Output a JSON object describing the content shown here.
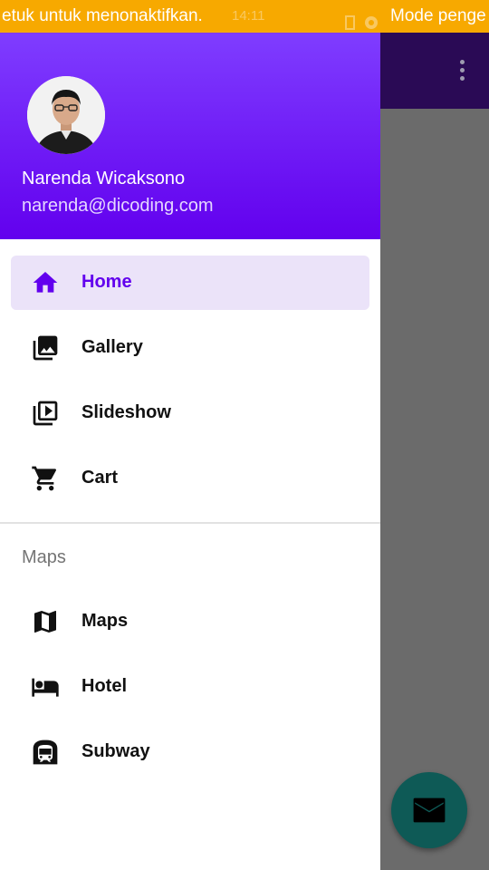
{
  "status_bar": {
    "left_text": "etuk untuk menonaktifkan.",
    "time": "14:11",
    "right_text": "Mode penge",
    "background": "#f7a900"
  },
  "drawer": {
    "header": {
      "name": "Narenda Wicaksono",
      "email": "narenda@dicoding.com",
      "gradient": [
        "#7f3dff",
        "#6200ee"
      ]
    },
    "items": [
      {
        "label": "Home",
        "icon": "home-icon",
        "active": true
      },
      {
        "label": "Gallery",
        "icon": "gallery-icon",
        "active": false
      },
      {
        "label": "Slideshow",
        "icon": "slideshow-icon",
        "active": false
      },
      {
        "label": "Cart",
        "icon": "cart-icon",
        "active": false
      }
    ],
    "section": {
      "title": "Maps",
      "items": [
        {
          "label": "Maps",
          "icon": "map-icon"
        },
        {
          "label": "Hotel",
          "icon": "hotel-icon"
        },
        {
          "label": "Subway",
          "icon": "subway-icon"
        }
      ]
    }
  },
  "fab": {
    "icon": "mail-icon",
    "color": "#0e5a56"
  },
  "colors": {
    "primary": "#6200ee",
    "active_bg": "#ebe3f9",
    "scrim": "#6b6b6b"
  }
}
